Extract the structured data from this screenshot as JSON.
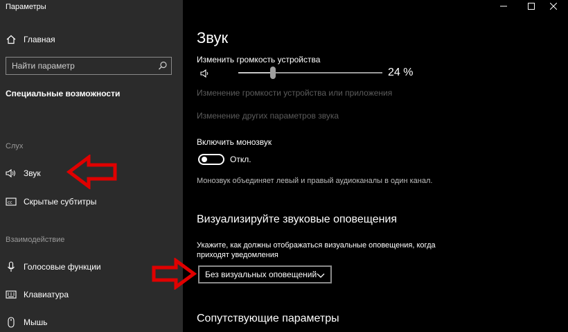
{
  "window": {
    "title": "Параметры",
    "controls": [
      "minimize",
      "maximize",
      "close"
    ]
  },
  "sidebar": {
    "home_label": "Главная",
    "search_placeholder": "Найти параметр",
    "category_title": "Специальные возможности",
    "groups": [
      {
        "header": "Слух",
        "items": [
          {
            "label": "Звук",
            "icon": "speaker-icon",
            "selected": true
          },
          {
            "label": "Скрытые субтитры",
            "icon": "closed-captions-icon"
          }
        ]
      },
      {
        "header": "Взаимодействие",
        "items": [
          {
            "label": "Голосовые функции",
            "icon": "microphone-icon"
          },
          {
            "label": "Клавиатура",
            "icon": "keyboard-icon"
          },
          {
            "label": "Мышь",
            "icon": "mouse-icon"
          }
        ]
      }
    ]
  },
  "main": {
    "title": "Звук",
    "volume": {
      "label": "Изменить громкость устройства",
      "value": 24,
      "value_text": "24 %"
    },
    "link_app_volume": "Изменение громкости устройства или приложения",
    "link_other_sound": "Изменение других параметров звука",
    "mono": {
      "label": "Включить монозвук",
      "state_text": "Откл.",
      "on": false,
      "description": "Монозвук объединяет левый и правый аудиоканалы в один канал."
    },
    "visualize": {
      "heading": "Визуализируйте звуковые оповещения",
      "description_line1": "Укажите, как должны отображаться визуальные оповещения, когда",
      "description_line2": "приходят уведомления",
      "dropdown_value": "Без визуальных оповещений"
    },
    "related_heading": "Сопутствующие параметры"
  },
  "colors": {
    "sidebar_bg": "#2b2b2b",
    "main_bg": "#000000",
    "annotation_arrow": "#e00000"
  }
}
